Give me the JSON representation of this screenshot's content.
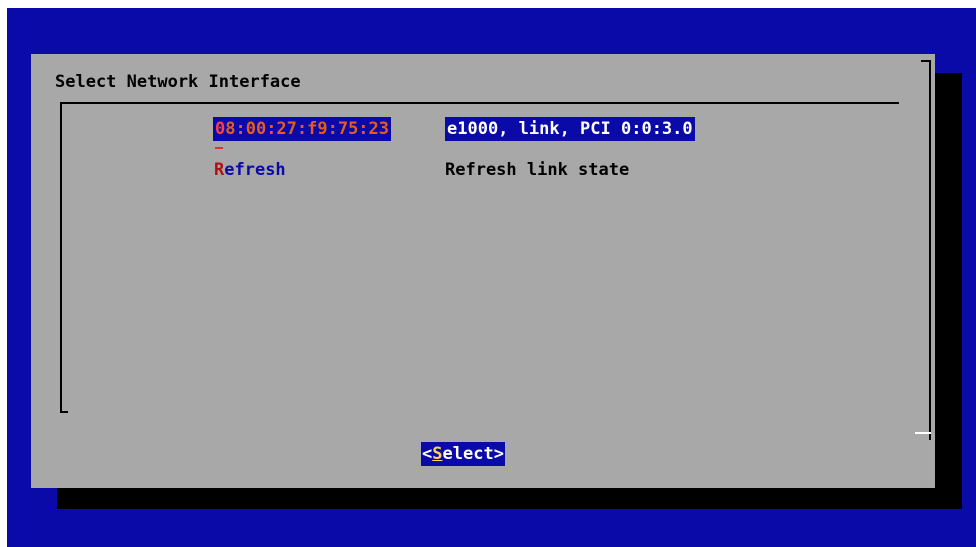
{
  "dialog": {
    "title": "Select Network Interface"
  },
  "menu": {
    "items": [
      {
        "hotkey": "0",
        "rest": "8:00:27:f9:75:23",
        "description": "e1000, link, PCI 0:0:3.0",
        "selected": true
      },
      {
        "hotkey": "R",
        "rest": "efresh",
        "description": "Refresh link state",
        "selected": false
      }
    ]
  },
  "buttons": {
    "select": {
      "open": "<",
      "hotkey": "S",
      "rest": "elect",
      "close": ">"
    }
  },
  "colors": {
    "screen_bg": "#0a0aa8",
    "dialog_bg": "#a8a8a8",
    "highlight_bg": "#0a0aa8",
    "hotkey": "#ff4040",
    "button_hotkey": "#ffd84a"
  }
}
